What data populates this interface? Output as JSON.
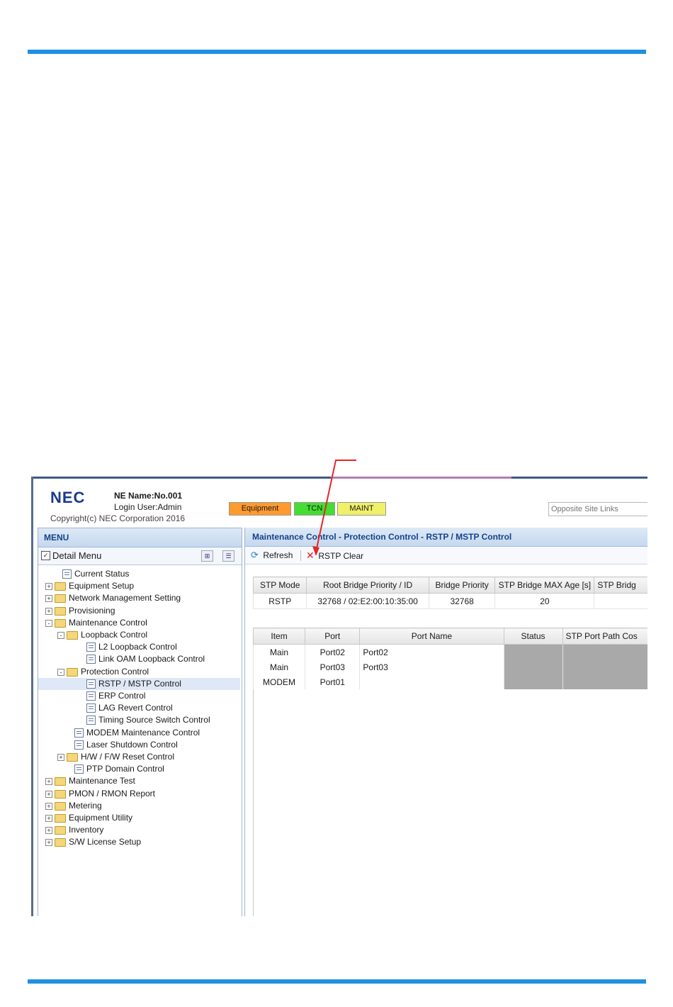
{
  "header": {
    "logo": "NEC",
    "ne_name": "NE Name:No.001",
    "login_user": "Login User:Admin",
    "copyright": "Copyright(c) NEC Corporation 2016",
    "status": {
      "equipment": "Equipment",
      "tcn": "TCN",
      "maint": "MAINT"
    },
    "opposite_placeholder": "Opposite Site Links"
  },
  "colors": {
    "equipment": "#ff9a2e",
    "tcn": "#44dd33",
    "maint": "#f0f06a",
    "rule": "#1e90e0"
  },
  "menu": {
    "title": "MENU",
    "detail_menu": "Detail Menu",
    "items": [
      {
        "label": "Current Status",
        "level": 0,
        "type": "page",
        "exp": ""
      },
      {
        "label": "Equipment Setup",
        "level": 0,
        "type": "folder",
        "exp": "+"
      },
      {
        "label": "Network Management Setting",
        "level": 0,
        "type": "folder",
        "exp": "+"
      },
      {
        "label": "Provisioning",
        "level": 0,
        "type": "folder",
        "exp": "+"
      },
      {
        "label": "Maintenance Control",
        "level": 0,
        "type": "folder",
        "exp": "-"
      },
      {
        "label": "Loopback Control",
        "level": 1,
        "type": "folder",
        "exp": "-"
      },
      {
        "label": "L2 Loopback Control",
        "level": 2,
        "type": "page",
        "exp": ""
      },
      {
        "label": "Link OAM Loopback Control",
        "level": 2,
        "type": "page",
        "exp": ""
      },
      {
        "label": "Protection Control",
        "level": 1,
        "type": "folder",
        "exp": "-"
      },
      {
        "label": "RSTP / MSTP Control",
        "level": 2,
        "type": "page",
        "exp": "",
        "selected": true
      },
      {
        "label": "ERP Control",
        "level": 2,
        "type": "page",
        "exp": ""
      },
      {
        "label": "LAG Revert Control",
        "level": 2,
        "type": "page",
        "exp": ""
      },
      {
        "label": "Timing Source Switch Control",
        "level": 2,
        "type": "page",
        "exp": ""
      },
      {
        "label": "MODEM Maintenance Control",
        "level": 1,
        "type": "page",
        "exp": ""
      },
      {
        "label": "Laser Shutdown Control",
        "level": 1,
        "type": "page",
        "exp": ""
      },
      {
        "label": "H/W / F/W Reset Control",
        "level": 1,
        "type": "folder",
        "exp": "+"
      },
      {
        "label": "PTP Domain Control",
        "level": 1,
        "type": "page",
        "exp": ""
      },
      {
        "label": "Maintenance Test",
        "level": 0,
        "type": "folder",
        "exp": "+"
      },
      {
        "label": "PMON / RMON Report",
        "level": 0,
        "type": "folder",
        "exp": "+"
      },
      {
        "label": "Metering",
        "level": 0,
        "type": "folder",
        "exp": "+"
      },
      {
        "label": "Equipment Utility",
        "level": 0,
        "type": "folder",
        "exp": "+"
      },
      {
        "label": "Inventory",
        "level": 0,
        "type": "folder",
        "exp": "+"
      },
      {
        "label": "S/W License Setup",
        "level": 0,
        "type": "folder",
        "exp": "+"
      }
    ]
  },
  "content": {
    "title": "Maintenance Control - Protection Control - RSTP / MSTP Control",
    "toolbar": {
      "refresh": "Refresh",
      "rstp_clear": "RSTP Clear"
    },
    "stp_table": {
      "headers": [
        "STP Mode",
        "Root Bridge Priority / ID",
        "Bridge Priority",
        "STP Bridge MAX Age [s]",
        "STP Bridg"
      ],
      "row": [
        "RSTP",
        "32768 / 02:E2:00:10:35:00",
        "32768",
        "20",
        ""
      ]
    },
    "port_table": {
      "headers": [
        "Item",
        "Port",
        "Port Name",
        "Status",
        "STP Port Path Cos"
      ],
      "rows": [
        [
          "Main",
          "Port02",
          "Port02",
          "",
          ""
        ],
        [
          "Main",
          "Port03",
          "Port03",
          "",
          ""
        ],
        [
          "MODEM",
          "Port01",
          "",
          "",
          ""
        ]
      ]
    }
  }
}
